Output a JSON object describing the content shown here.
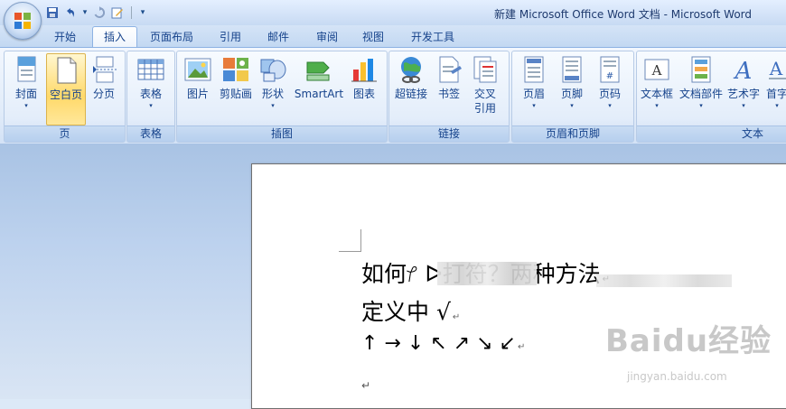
{
  "window": {
    "title": "新建 Microsoft Office Word 文档 - Microsoft Word"
  },
  "quick_access": {
    "items": [
      "save-icon",
      "undo-icon",
      "redo-icon",
      "edit-icon"
    ],
    "more_glyph": "▾"
  },
  "tabs": [
    {
      "label": "开始"
    },
    {
      "label": "插入",
      "active": true
    },
    {
      "label": "页面布局"
    },
    {
      "label": "引用"
    },
    {
      "label": "邮件"
    },
    {
      "label": "审阅"
    },
    {
      "label": "视图"
    },
    {
      "label": "开发工具"
    }
  ],
  "ribbon": {
    "groups": {
      "page": {
        "label": "页",
        "buttons": {
          "cover": "封面",
          "blank": "空白页",
          "break": "分页"
        }
      },
      "table": {
        "label": "表格",
        "buttons": {
          "table": "表格"
        }
      },
      "illustrations": {
        "label": "插图",
        "buttons": {
          "picture": "图片",
          "clipart": "剪贴画",
          "shapes": "形状",
          "smartart": "SmartArt",
          "chart": "图表"
        }
      },
      "links": {
        "label": "链接",
        "buttons": {
          "hyperlink": "超链接",
          "bookmark": "书签",
          "crossref_1": "交叉",
          "crossref_2": "引用"
        }
      },
      "header_footer": {
        "label": "页眉和页脚",
        "buttons": {
          "header": "页眉",
          "footer": "页脚",
          "pagenum": "页码"
        }
      },
      "text": {
        "label": "文本",
        "buttons": {
          "textbox": "文本框",
          "quickparts": "文档部件",
          "wordart": "艺术字",
          "dropcap": "首字"
        }
      }
    },
    "dropdown_glyph": "▾"
  },
  "document": {
    "line1": "如何ᜣ          ᐅ打符？两种方法",
    "line2": "定义中 √",
    "line3": "↑ → ↓ ↖ ↗ ↘ ↙",
    "paragraph_mark": "↵"
  },
  "watermark": {
    "logo": "Baidu经验",
    "url": "jingyan.baidu.com"
  },
  "colors": {
    "accent": "#15428b",
    "ribbon_bg": "#dce9f7",
    "highlight": "#ffd96a"
  }
}
